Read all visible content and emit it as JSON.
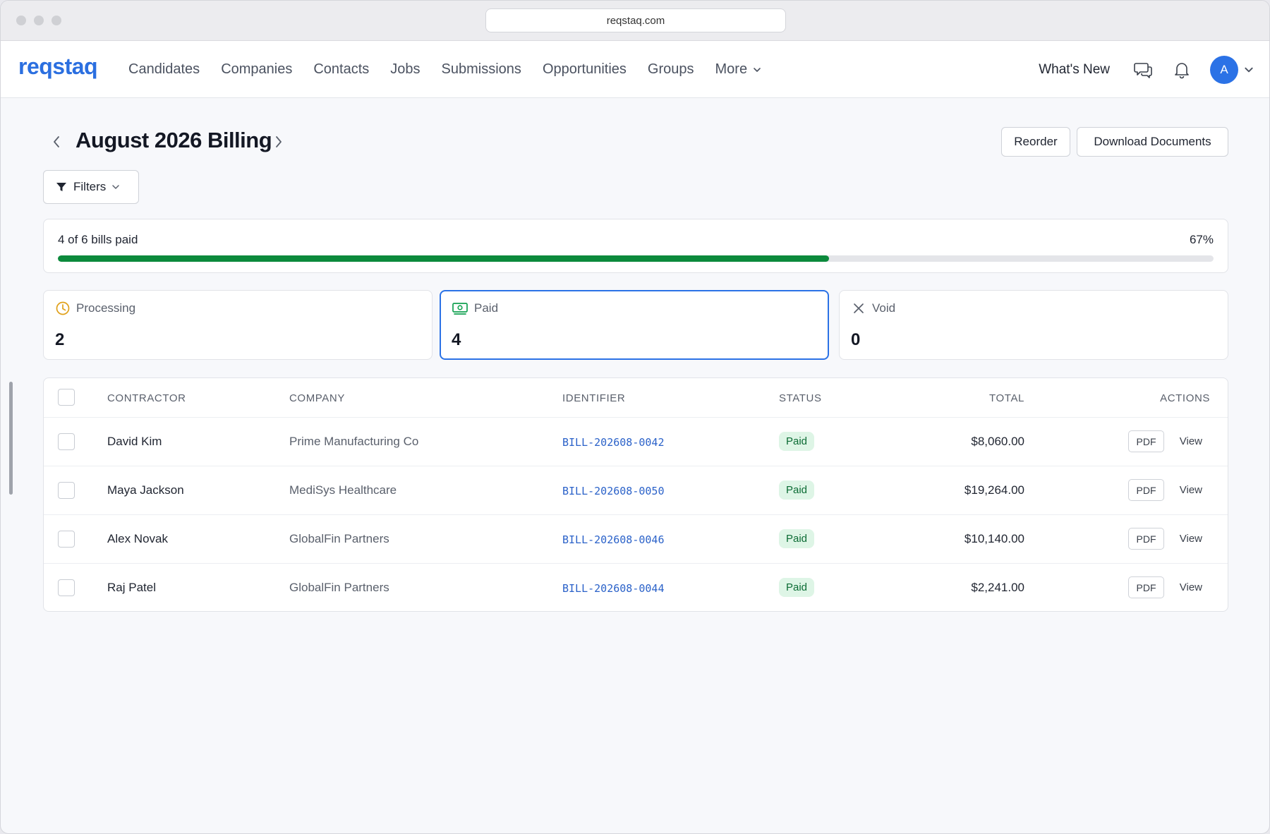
{
  "browser": {
    "url": "reqstaq.com"
  },
  "nav": {
    "logo": "reqstaq",
    "items": [
      "Candidates",
      "Companies",
      "Contacts",
      "Jobs",
      "Submissions",
      "Opportunities",
      "Groups"
    ],
    "more_label": "More",
    "whats_new": "What's New",
    "avatar_initial": "A"
  },
  "header": {
    "title": "August 2026 Billing",
    "reorder_label": "Reorder",
    "download_label": "Download Documents",
    "filters_label": "Filters"
  },
  "progress": {
    "label": "4 of 6 bills paid",
    "percent_label": "67%",
    "fraction": 0.667,
    "color": "#0c8a3c"
  },
  "stats": [
    {
      "label": "Processing",
      "value": "2",
      "icon": "clock-icon"
    },
    {
      "label": "Paid",
      "value": "4",
      "icon": "money-icon",
      "active": true
    },
    {
      "label": "Void",
      "value": "0",
      "icon": "close-icon"
    }
  ],
  "table": {
    "columns": {
      "contractor": "CONTRACTOR",
      "company": "COMPANY",
      "identifier": "IDENTIFIER",
      "status": "STATUS",
      "total": "TOTAL",
      "actions": "ACTIONS"
    },
    "rows": [
      {
        "contractor": "David Kim",
        "company": "Prime Manufacturing Co",
        "identifier": "BILL-202608-0042",
        "status": "Paid",
        "total": "$8,060.00",
        "pdf": "PDF",
        "view": "View"
      },
      {
        "contractor": "Maya Jackson",
        "company": "MediSys Healthcare",
        "identifier": "BILL-202608-0050",
        "status": "Paid",
        "total": "$19,264.00",
        "pdf": "PDF",
        "view": "View"
      },
      {
        "contractor": "Alex Novak",
        "company": "GlobalFin Partners",
        "identifier": "BILL-202608-0046",
        "status": "Paid",
        "total": "$10,140.00",
        "pdf": "PDF",
        "view": "View"
      },
      {
        "contractor": "Raj Patel",
        "company": "GlobalFin Partners",
        "identifier": "BILL-202608-0044",
        "status": "Paid",
        "total": "$2,241.00",
        "pdf": "PDF",
        "view": "View"
      }
    ]
  },
  "colors": {
    "accent": "#2b72e6",
    "brand": "#2b6fe0",
    "paid_badge_bg": "#def5e6",
    "paid_badge_text": "#0b6b34"
  }
}
